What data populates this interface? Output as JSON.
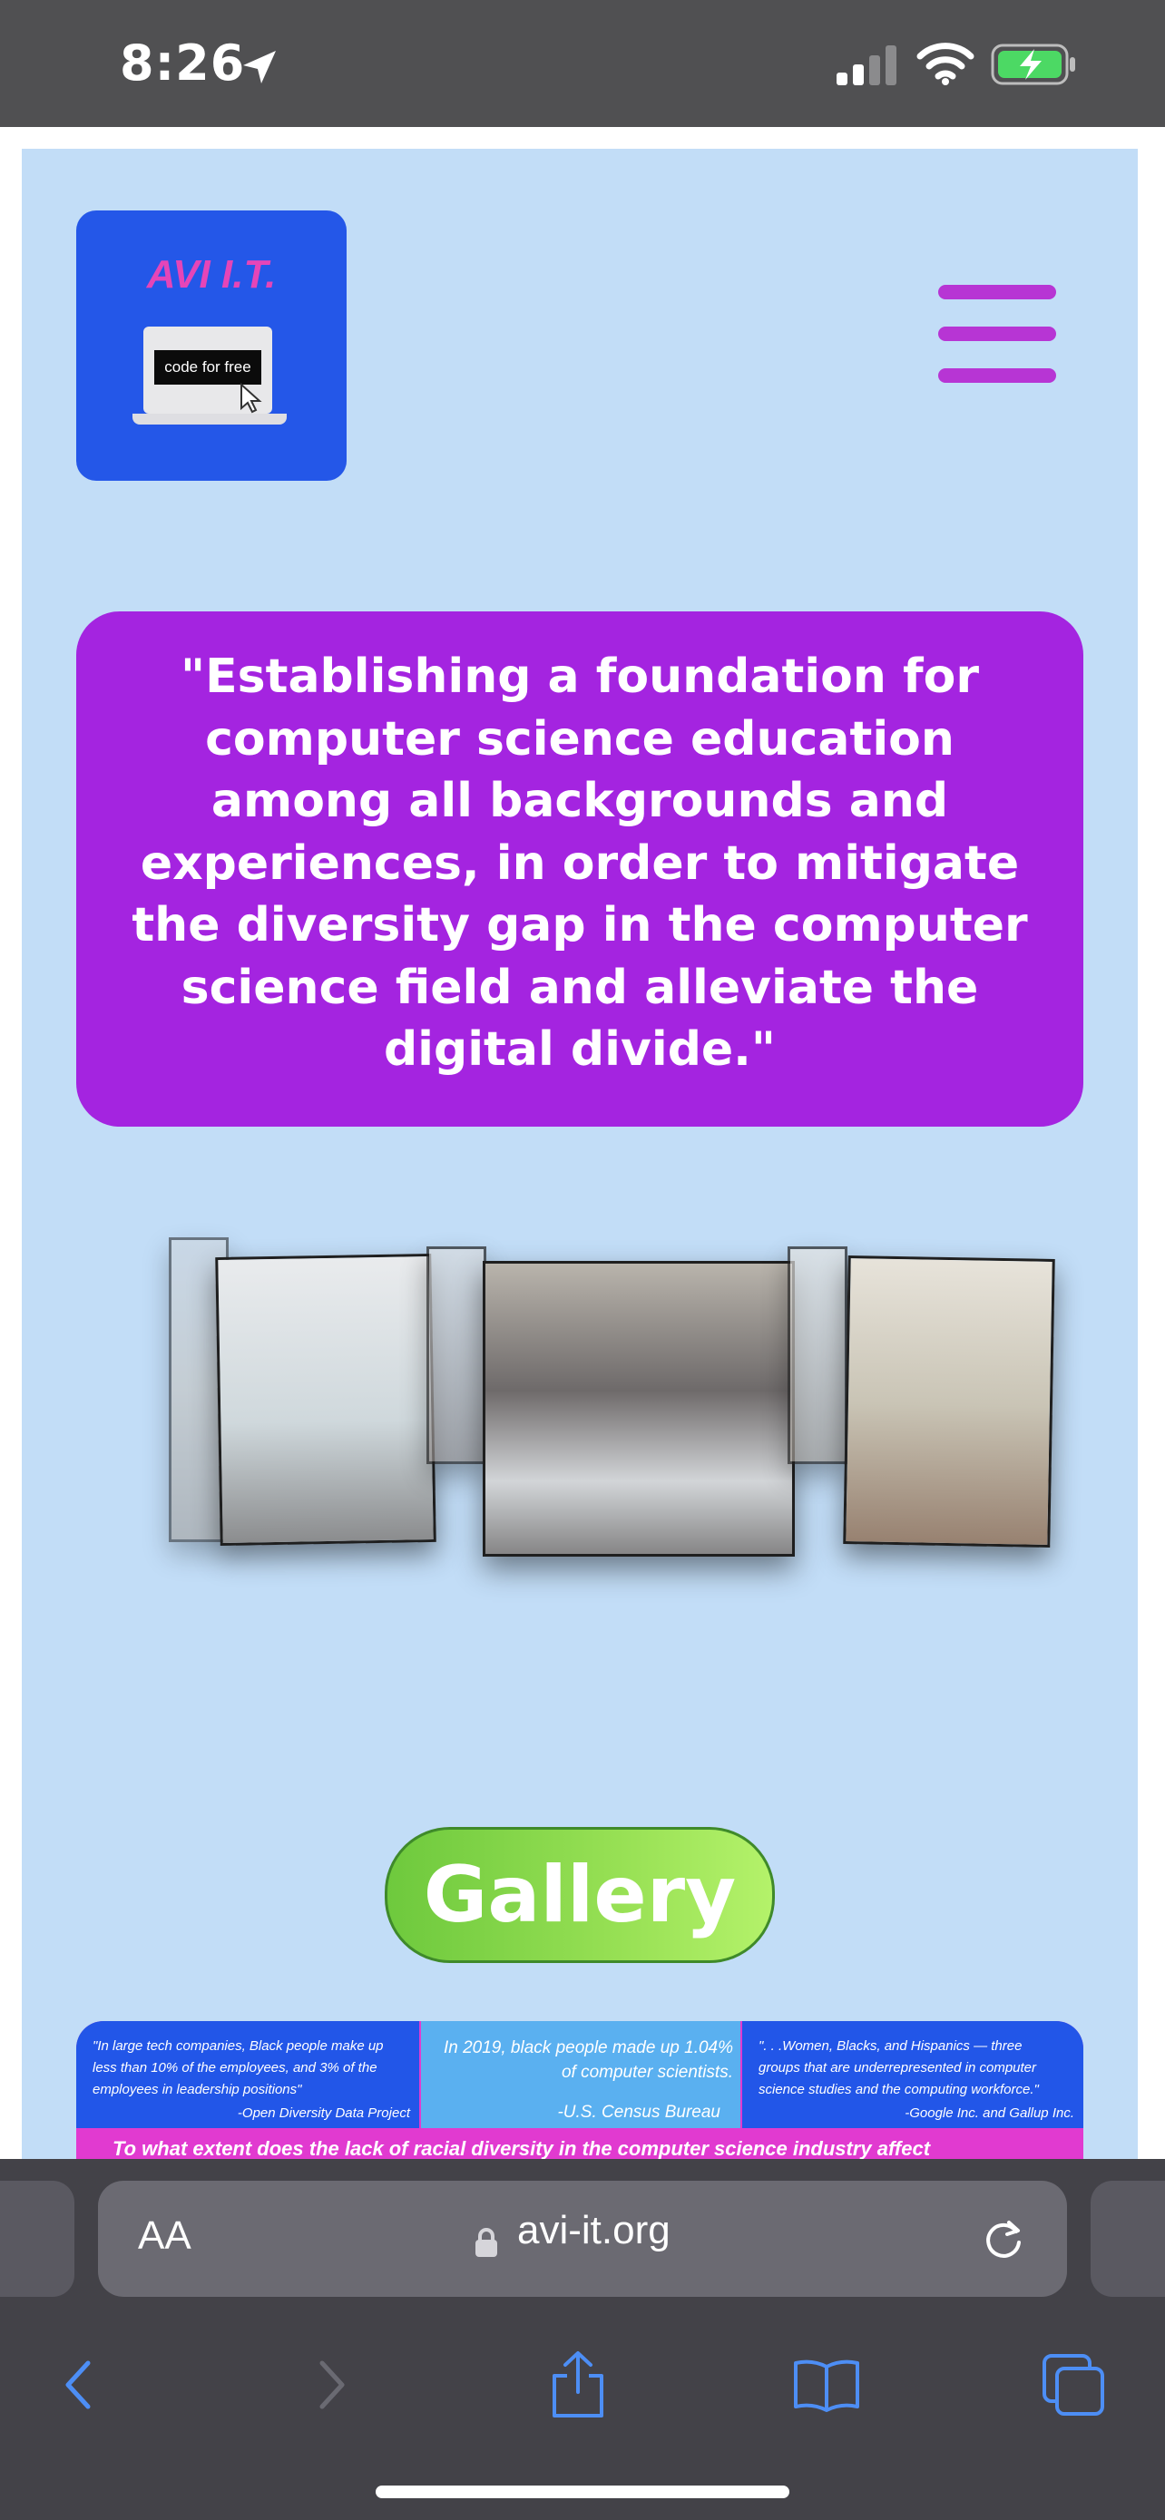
{
  "status_bar": {
    "time": "8:26"
  },
  "header": {
    "logo_title": "AVI I.T.",
    "logo_laptop_label": "code for free"
  },
  "mission": {
    "text": "\"Establishing a foundation for computer science education among all backgrounds and experiences, in order to mitigate the diversity gap in the computer science field and alleviate the digital divide.\""
  },
  "gallery": {
    "button_label": "Gallery"
  },
  "stats": [
    {
      "quote": "\"In large tech companies, Black people make up less than 10% of the employees, and 3% of the employees in leadership positions\"",
      "source": "-Open Diversity Data  Project"
    },
    {
      "quote": "In 2019, black people made up 1.04% of computer scientists.",
      "source": "-U.S. Census Bureau"
    },
    {
      "quote": "\". . .Women, Blacks, and Hispanics — three groups that are underrepresented in computer science studies and the computing workforce.\"",
      "source": "-Google Inc. and Gallup Inc."
    }
  ],
  "stats_question": "To what extent does the lack of racial diversity in the computer science industry affect",
  "browser": {
    "text_size_label": "AA",
    "url": "avi-it.org"
  },
  "colors": {
    "page_bg": "#c2ddf7",
    "mission_bg": "#a424e0",
    "logo_bg": "#2457e8",
    "menu": "#b735d4",
    "gallery_green": "#8fdc4f",
    "toolbar_bg": "#434248",
    "nav_icon": "#4d8ef5"
  },
  "icons": {
    "status": [
      "location-arrow-icon",
      "cellular-signal-icon",
      "wifi-icon",
      "battery-charging-icon"
    ],
    "toolbar": [
      "back-icon",
      "forward-icon",
      "share-icon",
      "bookmarks-icon",
      "tabs-icon",
      "lock-icon",
      "reload-icon"
    ]
  }
}
